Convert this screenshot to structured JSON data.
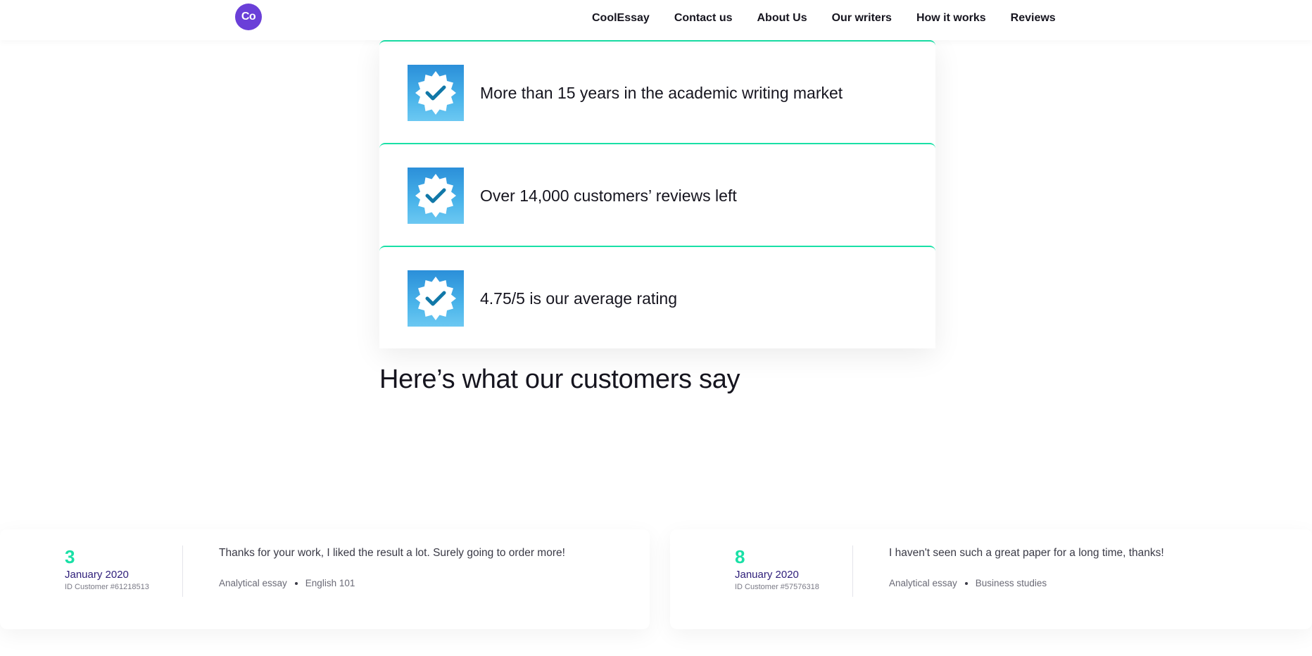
{
  "header": {
    "logo_text": "Co",
    "nav": [
      "CoolEssay",
      "Contact us",
      "About Us",
      "Our writers",
      "How it works",
      "Reviews"
    ]
  },
  "stats": [
    {
      "text": "More than 15 years in the academic writing market",
      "icon": "verified-badge-icon"
    },
    {
      "text": "Over 14,000 customers’ reviews left",
      "icon": "verified-badge-icon"
    },
    {
      "text": "4.75/5 is our average rating",
      "icon": "verified-badge-icon"
    }
  ],
  "section": {
    "title": "Here’s what our customers say"
  },
  "reviews": [
    {
      "day": "3",
      "month": "January 2020",
      "customer_id": "ID Customer #61218513",
      "text": "Thanks for your work, I liked the result a lot. Surely going to order more!",
      "tags": [
        "Analytical essay",
        "English 101"
      ]
    },
    {
      "day": "8",
      "month": "January 2020",
      "customer_id": "ID Customer #57576318",
      "text": "I haven't seen such a great paper for a long time, thanks!",
      "tags": [
        "Analytical essay",
        "Business studies"
      ]
    }
  ],
  "colors": {
    "brand_purple": "#6a3fd8",
    "accent_green": "#19e0a6",
    "badge_blue": "#2b8fd9",
    "month_purple": "#2e1e7a"
  }
}
